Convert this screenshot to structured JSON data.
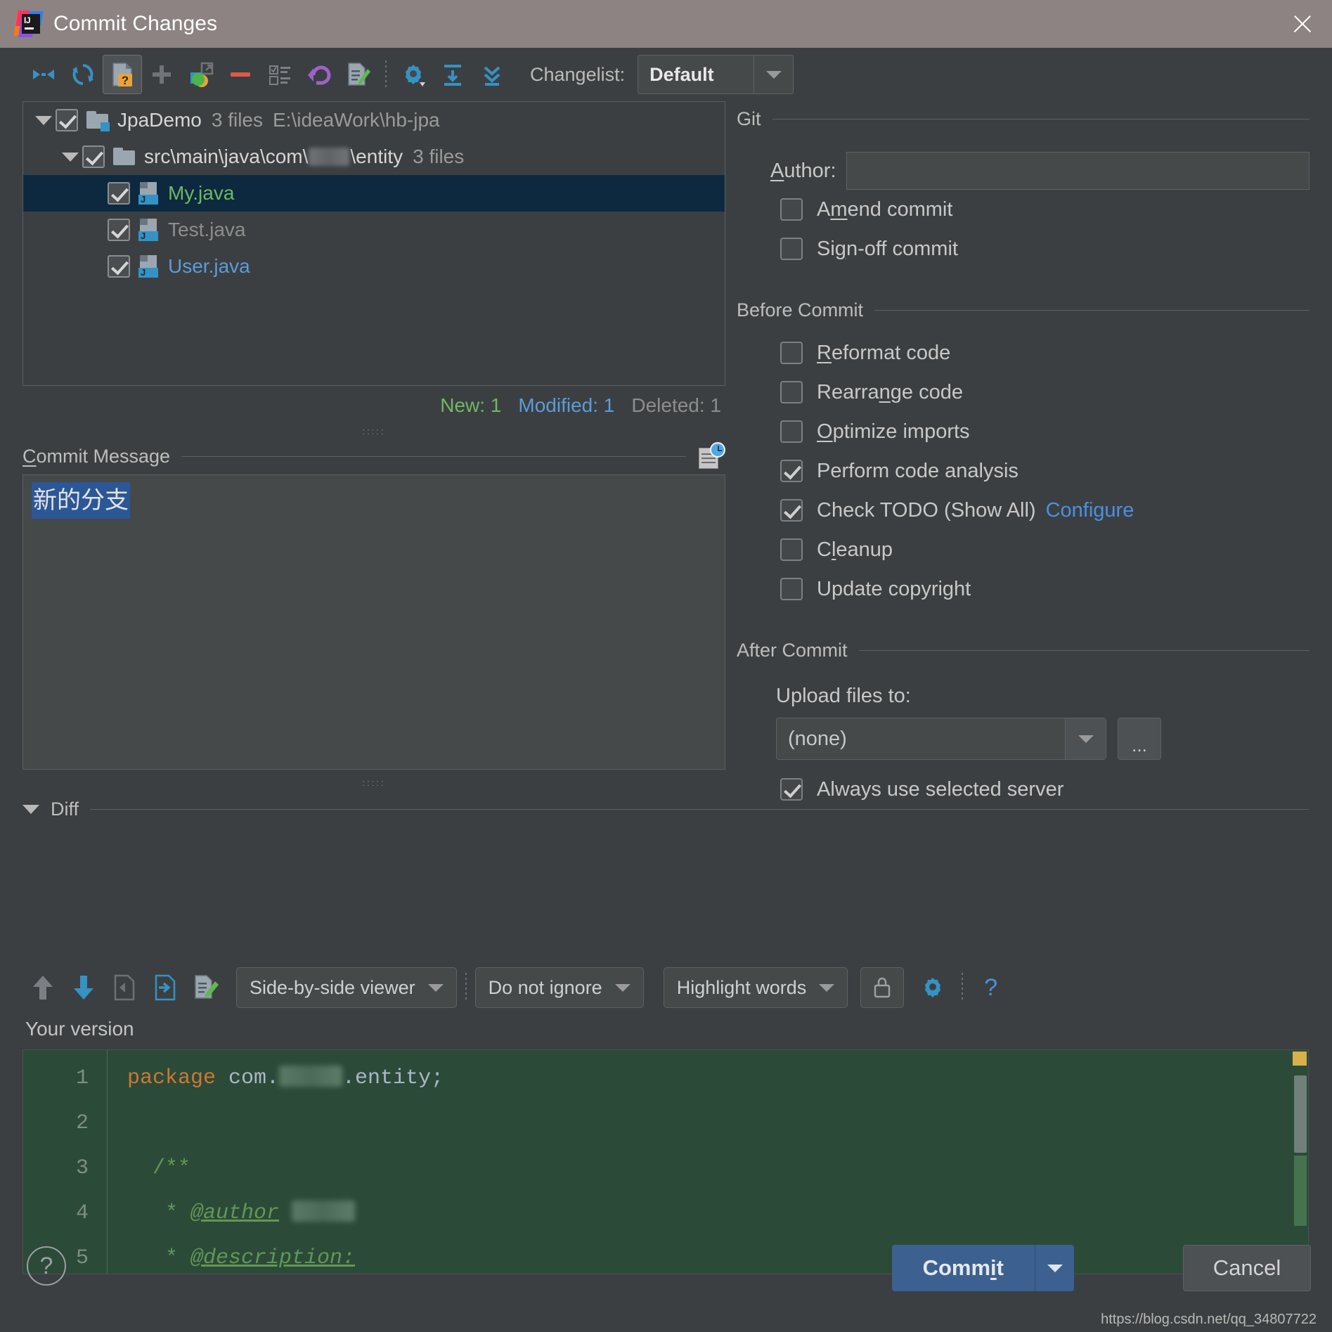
{
  "window": {
    "title": "Commit Changes",
    "logo_text": "IJ",
    "close_icon": "close-icon"
  },
  "toolbar": {
    "icons": [
      "collapse-all-icon",
      "refresh-icon",
      "show-unversioned-icon",
      "add-icon",
      "move-to-changelist-icon",
      "delete-icon",
      "group-by-icon",
      "rollback-icon",
      "show-diff-icon",
      "settings-icon",
      "expand-all-icon",
      "collapse-selected-icon"
    ],
    "changelist_label": "Changelist:",
    "changelist_value": "Default"
  },
  "file_tree": {
    "rows": [
      {
        "kind": "project",
        "indent": 0,
        "expanded": true,
        "checked": true,
        "icon": "module-folder-icon",
        "name": "JpaDemo",
        "count": "3 files",
        "path": "E:\\ideaWork\\hb-jpa",
        "selected": false
      },
      {
        "kind": "folder",
        "indent": 1,
        "expanded": true,
        "checked": true,
        "icon": "folder-icon",
        "name_prefix": "src\\main\\java\\com\\",
        "name_suffix": "\\entity",
        "count": "3 files",
        "selected": false
      },
      {
        "kind": "file",
        "indent": 2,
        "checked": true,
        "icon": "java-file-icon",
        "name": "My.java",
        "status": "new",
        "selected": true
      },
      {
        "kind": "file",
        "indent": 2,
        "checked": true,
        "icon": "java-file-icon",
        "name": "Test.java",
        "status": "deleted",
        "selected": false
      },
      {
        "kind": "file",
        "indent": 2,
        "checked": true,
        "icon": "java-file-icon",
        "name": "User.java",
        "status": "modified",
        "selected": false
      }
    ]
  },
  "status_counts": {
    "new": "New: 1",
    "modified": "Modified: 1",
    "deleted": "Deleted: 1",
    "color_new": "#6fb862",
    "color_modified": "#5a9cd8",
    "color_deleted": "#8d8d8d"
  },
  "commit_message": {
    "label": "Commit Message",
    "history_icon": "commit-history-icon",
    "value": "新的分支"
  },
  "git_panel": {
    "group_title": "Git",
    "author_label": "Author:",
    "author_value": "",
    "options": [
      {
        "label": "Amend commit",
        "checked": false,
        "name": "amend-commit"
      },
      {
        "label": "Sign-off commit",
        "checked": false,
        "name": "sign-off-commit"
      }
    ]
  },
  "before_commit": {
    "group_title": "Before Commit",
    "options": [
      {
        "label": "Reformat code",
        "checked": false,
        "name": "reformat-code"
      },
      {
        "label": "Rearrange code",
        "checked": false,
        "name": "rearrange-code"
      },
      {
        "label": "Optimize imports",
        "checked": false,
        "name": "optimize-imports"
      },
      {
        "label": "Perform code analysis",
        "checked": true,
        "name": "perform-code-analysis"
      },
      {
        "label": "Check TODO (Show All)",
        "checked": true,
        "name": "check-todo",
        "link": "Configure"
      },
      {
        "label": "Cleanup",
        "checked": false,
        "name": "cleanup"
      },
      {
        "label": "Update copyright",
        "checked": false,
        "name": "update-copyright"
      }
    ]
  },
  "after_commit": {
    "group_title": "After Commit",
    "upload_label": "Upload files to:",
    "upload_value": "(none)",
    "browse_label": "...",
    "always_use_label": "Always use selected server",
    "always_use_checked": true
  },
  "diff": {
    "section_label": "Diff",
    "toolbar_icons": [
      "previous-difference-icon",
      "next-difference-icon",
      "revert-icon",
      "apply-icon",
      "compare-icon"
    ],
    "viewer_mode": "Side-by-side viewer",
    "whitespace_mode": "Do not ignore",
    "highlight_mode": "Highlight words",
    "lock_icon": "lock-icon",
    "settings_icon": "gear-icon",
    "help_icon": "question-mark-icon",
    "your_version_label": "Your version",
    "line_numbers": [
      "1",
      "2",
      "3",
      "4",
      "5"
    ],
    "code_lines": [
      {
        "segments": [
          {
            "text": "package ",
            "type": "keyword"
          },
          {
            "text": "com.",
            "type": "plain"
          },
          {
            "text": "",
            "type": "blur"
          },
          {
            "text": ".entity;",
            "type": "plain"
          }
        ]
      },
      {
        "segments": []
      },
      {
        "segments": [
          {
            "text": "  /**",
            "type": "comment"
          }
        ]
      },
      {
        "segments": [
          {
            "text": "   * ",
            "type": "comment"
          },
          {
            "text": "@author",
            "type": "comment-underline"
          },
          {
            "text": " ",
            "type": "plain"
          },
          {
            "text": "",
            "type": "blur"
          }
        ]
      },
      {
        "segments": [
          {
            "text": "   * ",
            "type": "comment"
          },
          {
            "text": "@description:",
            "type": "comment-underline"
          }
        ]
      }
    ]
  },
  "footer": {
    "help_label": "?",
    "commit_label": "Commit",
    "commit_dropdown_icon": "chevron-down-icon",
    "cancel_label": "Cancel",
    "watermark": "https://blog.csdn.net/qq_34807722"
  }
}
